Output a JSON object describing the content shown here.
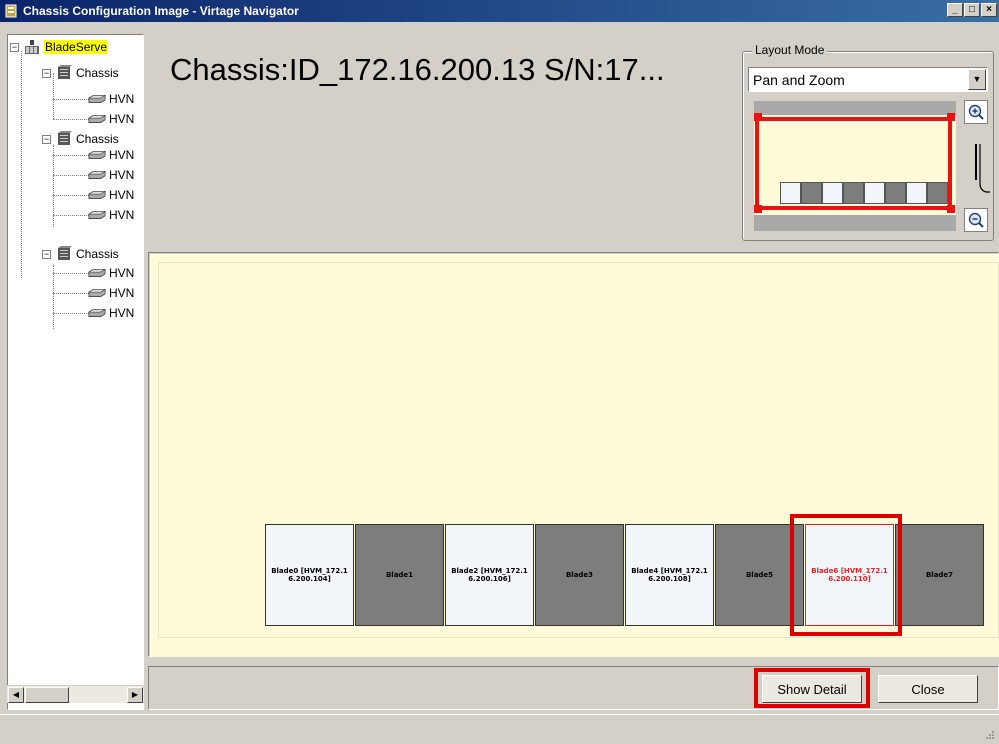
{
  "window": {
    "title": "Chassis Configuration Image - Virtage Navigator"
  },
  "tree": {
    "root": {
      "label": "BladeServe"
    },
    "chassis": [
      {
        "label": "Chassis",
        "children": [
          "HVN",
          "HVN"
        ]
      },
      {
        "label": "Chassis",
        "children": [
          "HVN",
          "HVN",
          "HVN",
          "HVN"
        ]
      },
      {
        "label": "Chassis",
        "children": [
          "HVN",
          "HVN",
          "HVN"
        ]
      }
    ]
  },
  "header": {
    "chassis_title": "Chassis:ID_172.16.200.13 S/N:17..."
  },
  "layout_mode": {
    "legend": "Layout Mode",
    "selected": "Pan and Zoom"
  },
  "blades": [
    {
      "label": "Blade0 [HVM_172.16.200.104]",
      "state": "light"
    },
    {
      "label": "Blade1",
      "state": "dark"
    },
    {
      "label": "Blade2 [HVM_172.16.200.106]",
      "state": "light"
    },
    {
      "label": "Blade3",
      "state": "dark"
    },
    {
      "label": "Blade4 [HVM_172.16.200.108]",
      "state": "light"
    },
    {
      "label": "Blade5",
      "state": "dark"
    },
    {
      "label": "Blade6 [HVM_172.16.200.110]",
      "state": "selected"
    },
    {
      "label": "Blade7",
      "state": "dark"
    }
  ],
  "buttons": {
    "show_detail": "Show Detail",
    "close": "Close"
  },
  "colors": {
    "canvas": "#fffbd8",
    "highlight": "#dd0000",
    "selected_text": "#e82020",
    "titlebar": "#0a246a"
  }
}
